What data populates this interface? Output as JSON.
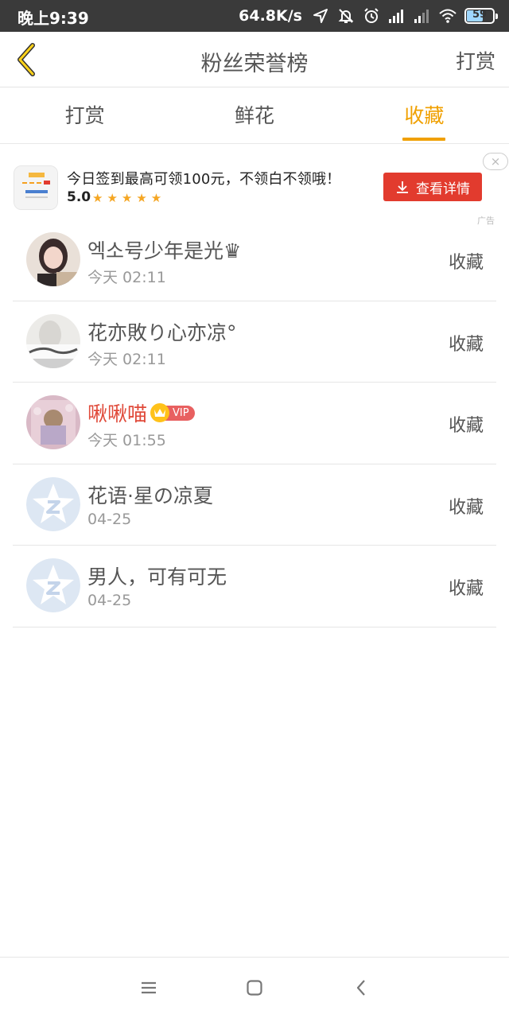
{
  "status_bar": {
    "time": "晚上9:39",
    "network_speed": "64.8K/s",
    "battery_level": "59"
  },
  "header": {
    "title": "粉丝荣誉榜",
    "action_label": "打赏"
  },
  "tabs": [
    {
      "label": "打赏",
      "active": false
    },
    {
      "label": "鲜花",
      "active": false
    },
    {
      "label": "收藏",
      "active": true
    }
  ],
  "ad": {
    "text": "今日签到最高可领100元，不领白不领哦！",
    "rating": "5.0",
    "stars": "★★★★★",
    "button_label": "查看详情",
    "close_label": "×",
    "ad_label": "广告"
  },
  "list": [
    {
      "name": "엑소号少年是光♛",
      "time": "今天 02:11",
      "action": "收藏",
      "vip": false
    },
    {
      "name": "花亦敗り心亦凉°",
      "time": "今天 02:11",
      "action": "收藏",
      "vip": false
    },
    {
      "name": "啾啾喵",
      "time": "今天 01:55",
      "action": "收藏",
      "vip": true,
      "vip_label": "VIP"
    },
    {
      "name": "花语·星の凉夏",
      "time": "04-25",
      "action": "收藏",
      "vip": false
    },
    {
      "name": "男人，可有可无",
      "time": "04-25",
      "action": "收藏",
      "vip": false
    }
  ],
  "colors": {
    "accent": "#f0a000",
    "ad_button": "#e23b2e",
    "vip_name": "#e04a3a",
    "status_bar": "#3a3a3a"
  }
}
